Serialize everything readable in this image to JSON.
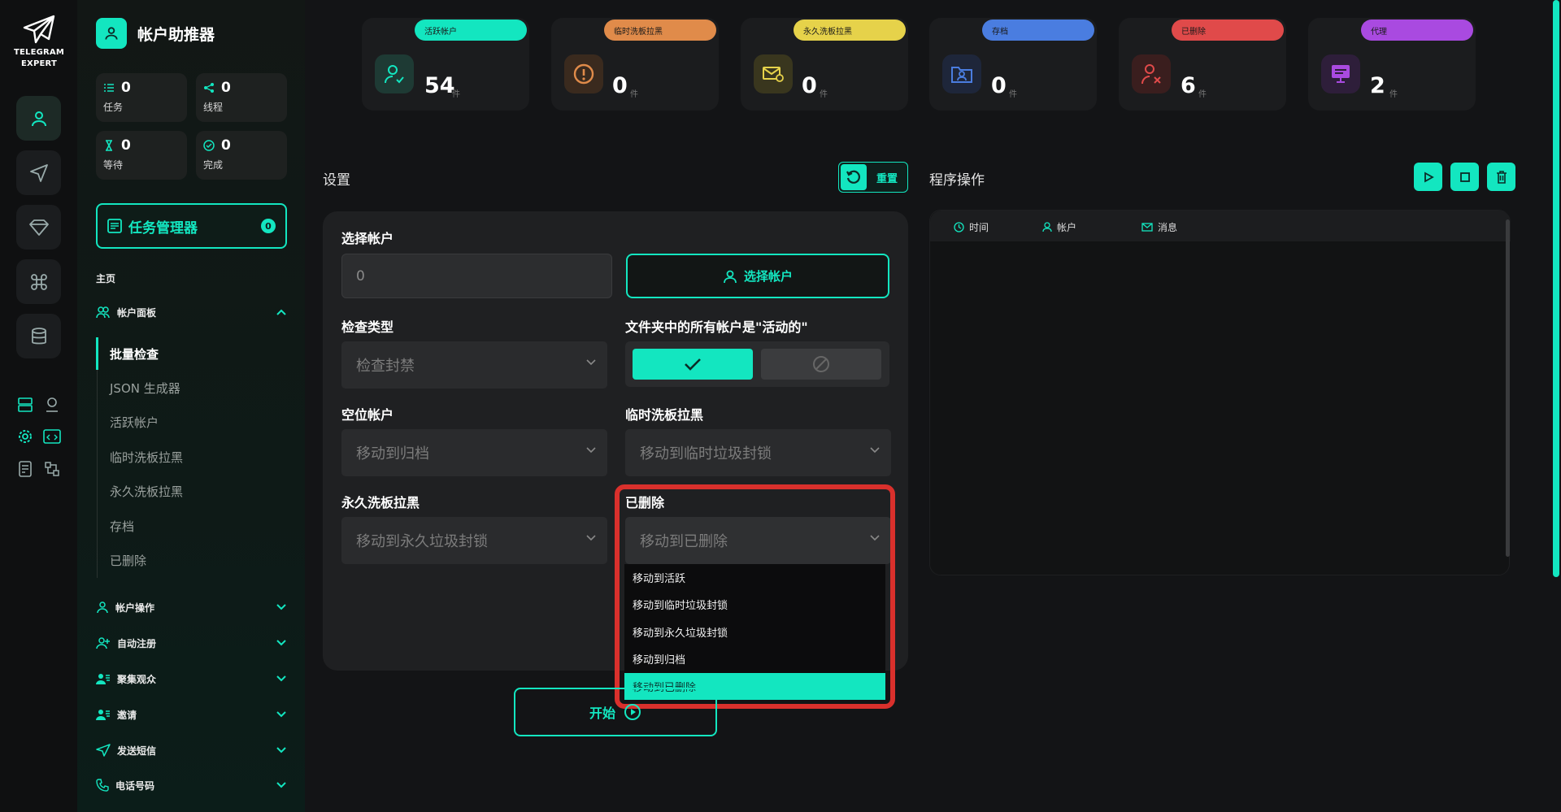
{
  "app": {
    "logo_line1": "TELEGRAM",
    "logo_line2": "EXPERT",
    "brand_title": "帐户助推器",
    "accent": "#13e6c0"
  },
  "rail_icons": [
    "user-icon",
    "send-icon",
    "diamond-icon",
    "command-icon",
    "database-icon"
  ],
  "sidebar": {
    "stats": [
      {
        "value": "0",
        "label": "任务",
        "icon": "list-icon"
      },
      {
        "value": "0",
        "label": "线程",
        "icon": "share-icon"
      },
      {
        "value": "0",
        "label": "等待",
        "icon": "hourglass-icon"
      },
      {
        "value": "0",
        "label": "完成",
        "icon": "check-circle-icon"
      }
    ],
    "task_manager": {
      "label": "任务管理器",
      "count": "0"
    },
    "section_title": "主页",
    "account_panel": "帐户面板",
    "submenu": [
      "批量检查",
      "JSON 生成器",
      "活跃帐户",
      "临时洗板拉黑",
      "永久洗板拉黑",
      "存档",
      "已删除"
    ],
    "groups": [
      "帐户操作",
      "自动注册",
      "聚集观众",
      "邀请",
      "发送短信",
      "电话号码"
    ]
  },
  "cards": [
    {
      "pill": "活跃帐户",
      "value": "54",
      "unit": "件",
      "color": "#13e6c0",
      "icon": "user-check-icon"
    },
    {
      "pill": "临时洗板拉黑",
      "value": "0",
      "unit": "件",
      "color": "#e08b4a",
      "icon": "alert-circle-icon"
    },
    {
      "pill": "永久洗板拉黑",
      "value": "0",
      "unit": "件",
      "color": "#e6d24a",
      "icon": "mail-block-icon"
    },
    {
      "pill": "存档",
      "value": "0",
      "unit": "件",
      "color": "#4a7de0",
      "icon": "folder-user-icon"
    },
    {
      "pill": "已删除",
      "value": "6",
      "unit": "件",
      "color": "#e04a4a",
      "icon": "user-x-icon"
    },
    {
      "pill": "代理",
      "value": "2",
      "unit": "件",
      "color": "#a94ae0",
      "icon": "proxy-icon"
    }
  ],
  "settings": {
    "title": "设置",
    "reset": "重置",
    "select_account_label": "选择帐户",
    "account_input_value": "0",
    "select_account_button": "选择帐户",
    "check_type_label": "检查类型",
    "check_type_value": "检查封禁",
    "all_active_label": "文件夹中的所有帐户是\"活动的\"",
    "idle_label": "空位帐户",
    "idle_value": "移动到归档",
    "temp_label": "临时洗板拉黑",
    "temp_value": "移动到临时垃圾封锁",
    "perm_label": "永久洗板拉黑",
    "perm_value": "移动到永久垃圾封锁",
    "deleted_label": "已删除",
    "deleted_value": "移动到已删除",
    "dropdown_options": [
      "移动到活跃",
      "移动到临时垃圾封锁",
      "移动到永久垃圾封锁",
      "移动到归档",
      "移动到已删除"
    ],
    "dropdown_selected": "移动到已删除",
    "start": "开始"
  },
  "log": {
    "title": "程序操作",
    "columns": [
      "时间",
      "帐户",
      "消息"
    ]
  }
}
